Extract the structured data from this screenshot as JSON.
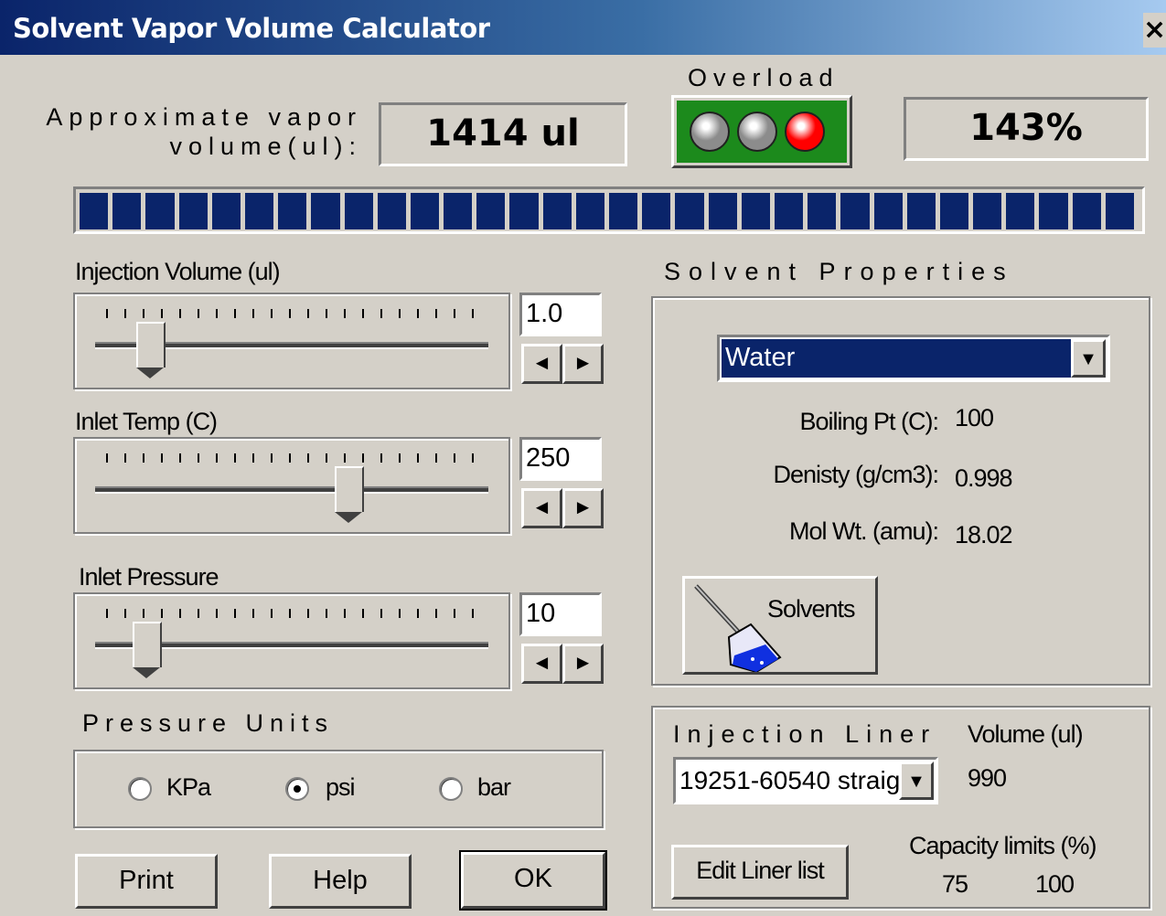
{
  "window": {
    "title": "Solvent Vapor Volume Calculator",
    "close_glyph": "×"
  },
  "vapor": {
    "label_line1": "Approximate vapor",
    "label_line2": "volume(ul):",
    "value": "1414 ul"
  },
  "overload": {
    "label": "Overload",
    "percent": "143%",
    "lights": [
      "off",
      "off",
      "on"
    ],
    "light_colors": {
      "off": "#8c8c8c",
      "on": "#ff0000",
      "panel": "#1c8a1c"
    }
  },
  "progress": {
    "value_fraction": 1.0,
    "segments": 32,
    "color": "#0a246a"
  },
  "injection_volume": {
    "label": "Injection Volume (ul)",
    "value": "1.0",
    "slider_fraction": 0.11
  },
  "inlet_temp": {
    "label": "Inlet Temp (C)",
    "value": "250",
    "slider_fraction": 0.64
  },
  "inlet_pressure": {
    "label": "Inlet Pressure",
    "value": "10",
    "slider_fraction": 0.1
  },
  "spin": {
    "left": "◄",
    "right": "►"
  },
  "pressure_units": {
    "label": "Pressure Units",
    "options": [
      {
        "label": "KPa",
        "selected": false
      },
      {
        "label": "psi",
        "selected": true
      },
      {
        "label": "bar",
        "selected": false
      }
    ]
  },
  "solvent": {
    "group_label": "Solvent Properties",
    "selected": "Water",
    "dropdown_arrow": "▼",
    "boiling_label": "Boiling Pt (C):",
    "boiling_value": "100",
    "density_label": "Denisty (g/cm3):",
    "density_value": "0.998",
    "molwt_label": "Mol Wt. (amu):",
    "molwt_value": "18.02",
    "solvents_button": "Solvents"
  },
  "liner": {
    "group_label": "Injection Liner",
    "selected": "19251-60540 straig",
    "volume_label": "Volume (ul)",
    "volume_value": "990",
    "edit_button": "Edit Liner list",
    "capacity_label": "Capacity limits (%)",
    "capacity_low": "75",
    "capacity_high": "100"
  },
  "buttons": {
    "print": "Print",
    "help": "Help",
    "ok": "OK"
  }
}
